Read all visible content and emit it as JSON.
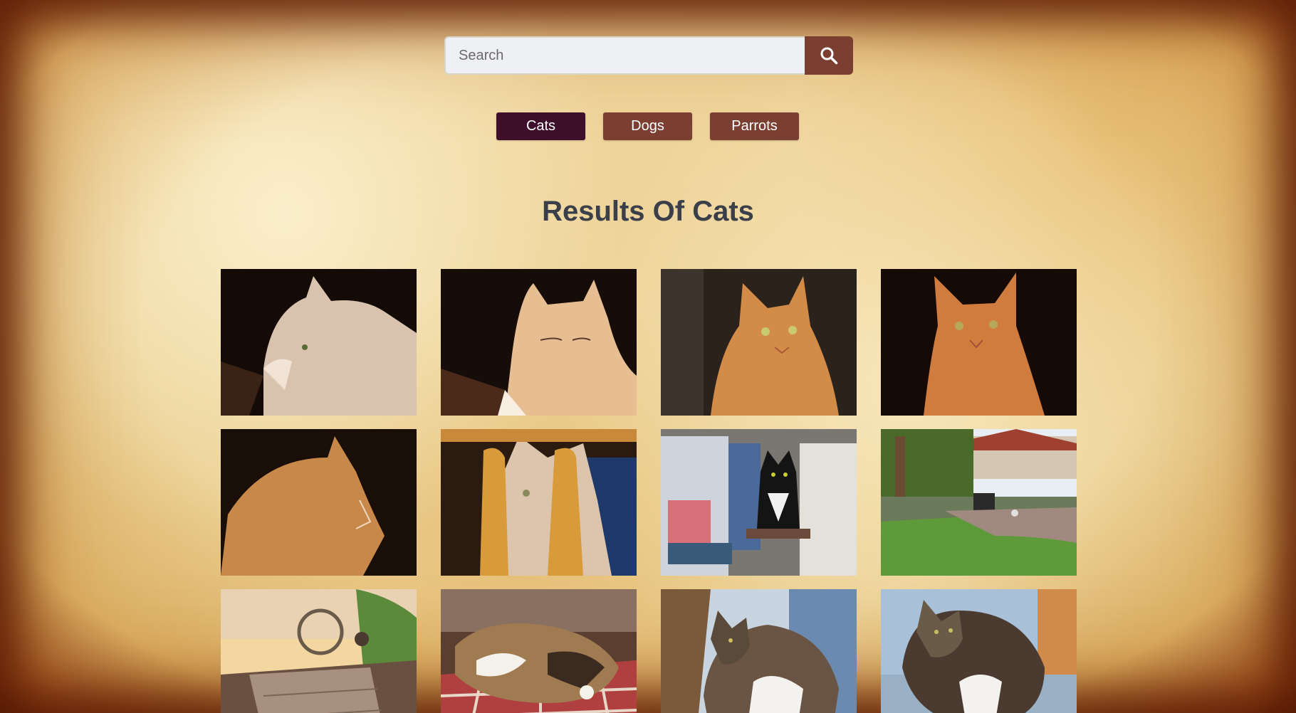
{
  "search": {
    "placeholder": "Search",
    "value": ""
  },
  "icons": {
    "search": "search-icon"
  },
  "filters": [
    {
      "label": "Cats",
      "active": true
    },
    {
      "label": "Dogs",
      "active": false
    },
    {
      "label": "Parrots",
      "active": false
    }
  ],
  "results": {
    "title": "Results Of Cats"
  },
  "colors": {
    "accent": "#7b3f32",
    "active_filter": "#3e0f2a",
    "title_text": "#3a3f4a",
    "parchment": "#ecd296"
  },
  "gallery": [
    {
      "name": "cat-photo-1",
      "bg": "#1a0f0a",
      "fg": "#d9c3ae"
    },
    {
      "name": "cat-photo-2",
      "bg": "#1c110a",
      "fg": "#e2b88e"
    },
    {
      "name": "cat-photo-3",
      "bg": "#231a14",
      "fg": "#d8914f"
    },
    {
      "name": "cat-photo-4",
      "bg": "#1a0f0a",
      "fg": "#d08442"
    },
    {
      "name": "cat-photo-5",
      "bg": "#1d1209",
      "fg": "#cc8a4c"
    },
    {
      "name": "cat-photo-6",
      "bg": "#4a3020",
      "fg": "#c99460"
    },
    {
      "name": "cat-photo-7",
      "bg": "#8f8c88",
      "fg": "#1a1a1a"
    },
    {
      "name": "cat-photo-8",
      "bg": "#5a8a3a",
      "fg": "#b9b9b9"
    },
    {
      "name": "cat-photo-9",
      "bg": "#c9a868",
      "fg": "#5a4a3a"
    },
    {
      "name": "cat-photo-10",
      "bg": "#6a4a3a",
      "fg": "#a07a50"
    },
    {
      "name": "cat-photo-11",
      "bg": "#8fa8c0",
      "fg": "#6a5a4a"
    },
    {
      "name": "cat-photo-12",
      "bg": "#9ab0c8",
      "fg": "#4a3a30"
    }
  ]
}
